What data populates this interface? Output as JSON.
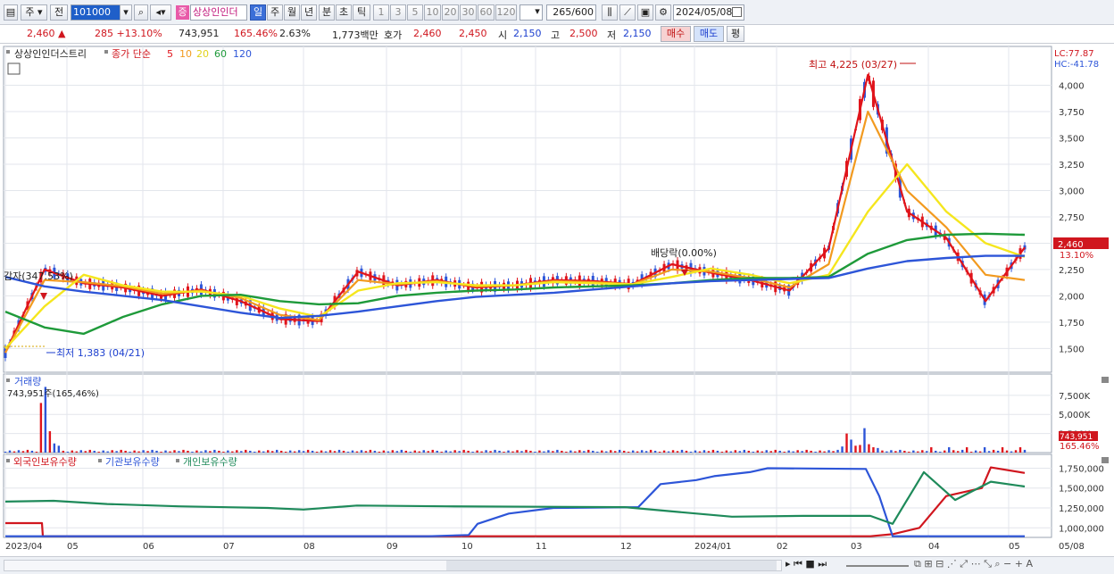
{
  "toolbar": {
    "market_btn": "주",
    "prev_btn": "전",
    "code": "101000",
    "stock_badge": "증",
    "stock_name": "상상인인더",
    "periods": [
      "일",
      "주",
      "월",
      "년",
      "분",
      "초",
      "틱"
    ],
    "intervals": [
      "1",
      "3",
      "5",
      "10",
      "20",
      "30",
      "60",
      "120"
    ],
    "count": "265",
    "count_total": "/600",
    "date": "2024/05/08"
  },
  "quote": {
    "price": "2,460",
    "change": "285 +13.10%",
    "volume": "743,951",
    "volume_ratio": "165.46%",
    "turnover_rate": "2.63%",
    "amount": "1,773백만",
    "ask_label": "호가",
    "ask": "2,460",
    "bid": "2,450",
    "open_label": "시",
    "open": "2,150",
    "high_label": "고",
    "high": "2,500",
    "low_label": "저",
    "low": "2,150",
    "buy_btn": "매수",
    "sell_btn": "매도",
    "eval_btn": "평"
  },
  "panels": {
    "price_title": "상상인인더스트리",
    "ma_label": "종가 단순",
    "ma_periods": [
      "5",
      "10",
      "20",
      "60",
      "120"
    ],
    "ma_colors": [
      "#e0141b",
      "#f29a1f",
      "#f5e61e",
      "#1e9a3a",
      "#2d55d8"
    ],
    "lc_label": "LC:77.87",
    "hc_label": "HC:-41.78",
    "price_tag": "2,460",
    "pct_tag": "13.10%",
    "volume_title": "거래량",
    "volume_value": "743,951주(165,46%)",
    "volume_tag": "743,951",
    "volume_pct_tag": "165.46%",
    "holdings_titles": [
      "외국인보유수량",
      "기관보유수량",
      "개인보유수량"
    ],
    "holdings_colors": [
      "#d0161e",
      "#2d55d8",
      "#1e8a5a"
    ]
  },
  "annotations": {
    "high": "최고 4,225 (03/27)",
    "low": "최저 1,383 (04/21)",
    "ex_div": "배당락(0.00%)",
    "capital": "감자(347.53%)"
  },
  "chart_data": [
    {
      "type": "candlestick",
      "title": "상상인인더스트리",
      "ylim": [
        1300,
        4250
      ],
      "y_ticks": [
        "4,000",
        "3,750",
        "3,500",
        "3,250",
        "3,000",
        "2,750",
        "2,500",
        "2,250",
        "2,000",
        "1,750",
        "1,500"
      ],
      "x_ticks": [
        "2023/04",
        "05",
        "06",
        "07",
        "08",
        "09",
        "10",
        "11",
        "12",
        "2024/01",
        "02",
        "03",
        "04",
        "05",
        "05/08"
      ],
      "series": [
        {
          "name": "5",
          "values": [
            1460,
            2250,
            2120,
            2080,
            2000,
            2060,
            1950,
            1780,
            1760,
            2230,
            2100,
            2150,
            2080,
            2100,
            2150,
            2140,
            2110,
            2300,
            2220,
            2150,
            2050,
            2450,
            4100,
            2800,
            2550,
            1950,
            2460
          ]
        },
        {
          "name": "10",
          "values": [
            1460,
            2150,
            2130,
            2090,
            2020,
            2050,
            1980,
            1820,
            1770,
            2150,
            2110,
            2140,
            2090,
            2100,
            2140,
            2130,
            2110,
            2250,
            2230,
            2170,
            2080,
            2300,
            3750,
            3000,
            2650,
            2200,
            2150
          ]
        },
        {
          "name": "20",
          "values": [
            1500,
            1900,
            2200,
            2100,
            2040,
            2040,
            2000,
            1880,
            1800,
            2050,
            2120,
            2130,
            2100,
            2100,
            2130,
            2120,
            2110,
            2180,
            2260,
            2200,
            2120,
            2200,
            2800,
            3250,
            2800,
            2500,
            2370
          ]
        },
        {
          "name": "60",
          "values": [
            1850,
            1700,
            1640,
            1800,
            1920,
            2000,
            2010,
            1950,
            1920,
            1930,
            2000,
            2030,
            2050,
            2060,
            2080,
            2090,
            2100,
            2120,
            2150,
            2170,
            2170,
            2180,
            2400,
            2530,
            2580,
            2590,
            2580
          ]
        },
        {
          "name": "120",
          "values": [
            2180,
            2090,
            2040,
            2000,
            1960,
            1900,
            1840,
            1790,
            1810,
            1850,
            1900,
            1950,
            1990,
            2010,
            2030,
            2060,
            2090,
            2120,
            2140,
            2150,
            2160,
            2170,
            2260,
            2330,
            2360,
            2380,
            2380
          ]
        }
      ],
      "last_price": 2460,
      "high": 4225,
      "low": 1383
    },
    {
      "type": "bar",
      "title": "거래량",
      "y_ticks": [
        "7,500K",
        "5,000K",
        "2,500K"
      ],
      "ylim": [
        0,
        9000000
      ],
      "last_value": 743951
    },
    {
      "type": "line",
      "series_names": [
        "외국인보유수량",
        "기관보유수량",
        "개인보유수량"
      ],
      "y_ticks": [
        "1,750,000",
        "1,500,000",
        "1,250,000",
        "1,000,000"
      ],
      "ylim": [
        880000,
        1800000
      ]
    }
  ]
}
